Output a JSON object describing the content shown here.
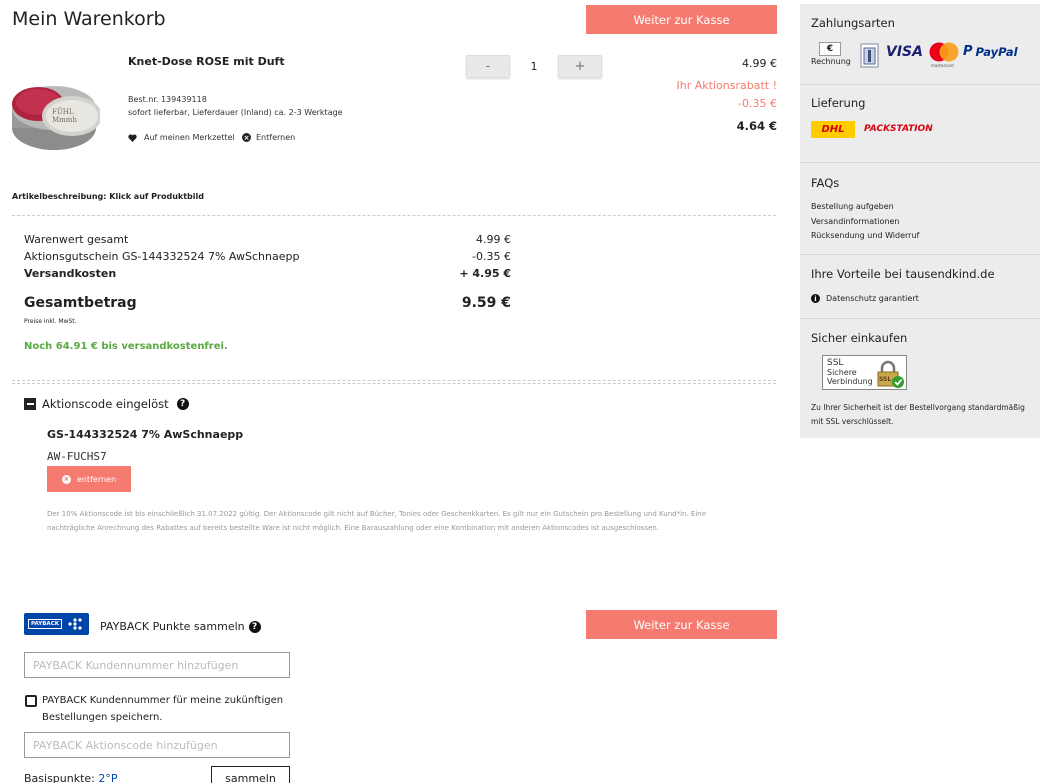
{
  "page": {
    "title": "Mein Warenkorb"
  },
  "actions": {
    "checkout_label": "Weiter zur Kasse"
  },
  "product": {
    "name": "Knet-Dose ROSE mit Duft",
    "article_no": "Best.nr. 139439118",
    "delivery": "sofort lieferbar, Lieferdauer (Inland) ca. 2-3 Werktage",
    "wishlist_label": "Auf meinen Merkzettel",
    "remove_label": "Entfernen",
    "quantity": "1",
    "qty_minus": "-",
    "qty_plus": "+",
    "price": "4.99 €",
    "promo_label": "Ihr Aktionsrabatt !",
    "promo_value": "-0.35 €",
    "final_price": "4.64 €",
    "image_text": "FÜHL Mmmh"
  },
  "description_hint": "Artikelbeschreibung: Klick auf Produktbild",
  "summary": {
    "rows": [
      {
        "label": "Warenwert gesamt",
        "value": "4.99 €"
      },
      {
        "label": "Aktionsgutschein GS-144332524 7% AwSchnaepp",
        "value": "-0.35 €"
      },
      {
        "label": "Versandkosten",
        "value": "+ 4.95 €"
      }
    ],
    "total_label": "Gesamtbetrag",
    "total_value": "9.59 €",
    "tax_note": "Preise inkl. MwSt.",
    "free_shipping": "Noch 64.91 € bis versandkostenfrei."
  },
  "promo_code": {
    "toggle_label": "Aktionscode eingelöst",
    "help": "?",
    "code_title": "GS-144332524 7% AwSchnaepp",
    "code": "AW-FUCHS7",
    "remove_label": "entfernen",
    "remove_x": "×",
    "terms_line1": "Der 10% Aktionscode ist bis einschließlich 31.07.2022 gültig. Der Aktionscode gilt nicht auf Bücher, Tonies oder Geschenkkarten. Es gilt nur ein Gutschein pro Bestellung und Kund*in. Eine",
    "terms_line2": "nachträgliche Anrechnung des Rabattes auf bereits bestellte Ware ist nicht möglich. Eine Barauszahlung oder eine Kombination mit anderen Aktionscodes ist ausgeschlossen."
  },
  "payback": {
    "logo_text": "PAYBACK",
    "collect_label": "PAYBACK Punkte sammeln",
    "help": "?",
    "number_placeholder": "PAYBACK Kundennummer hinzufügen",
    "save_label_line1": "PAYBACK Kundennummer für meine zukünftigen",
    "save_label_line2": "Bestellungen speichern.",
    "code_placeholder": "PAYBACK Aktionscode hinzufügen",
    "base_points_label": "Basispunkte:",
    "base_points_value": "2°P",
    "collect_button": "sammeln"
  },
  "sidebar": {
    "payment_title": "Zahlungsarten",
    "invoice_label": "Rechnung",
    "invoice_symbol": "€",
    "visa": "VISA",
    "mastercard": "mastercard",
    "paypal_p": "P",
    "paypal": "PayPal",
    "delivery_title": "Lieferung",
    "dhl": "DHL",
    "packstation": "PACKSTATION",
    "faq_title": "FAQs",
    "faq_links": [
      "Bestellung aufgeben",
      "Versandinformationen",
      "Rücksendung und Widerruf"
    ],
    "benefits_title": "Ihre Vorteile bei tausendkind.de",
    "privacy_label": "Datenschutz garantiert",
    "privacy_icon": "i",
    "secure_title": "Sicher einkaufen",
    "ssl_line1": "SSL",
    "ssl_line2": "Sichere",
    "ssl_line3": "Verbindung",
    "ssl_badge": "SSL",
    "secure_text_line1": "Zu Ihrer Sicherheit ist der Bestellvorgang standardmäßig",
    "secure_text_line2": "mit SSL verschlüsselt."
  },
  "colors": {
    "accent": "#f57b70",
    "green": "#5aa843",
    "sidebar_bg": "#ececec",
    "dhl_yellow": "#ffcc00",
    "dhl_red": "#d40511",
    "payback_blue": "#0046aa"
  }
}
